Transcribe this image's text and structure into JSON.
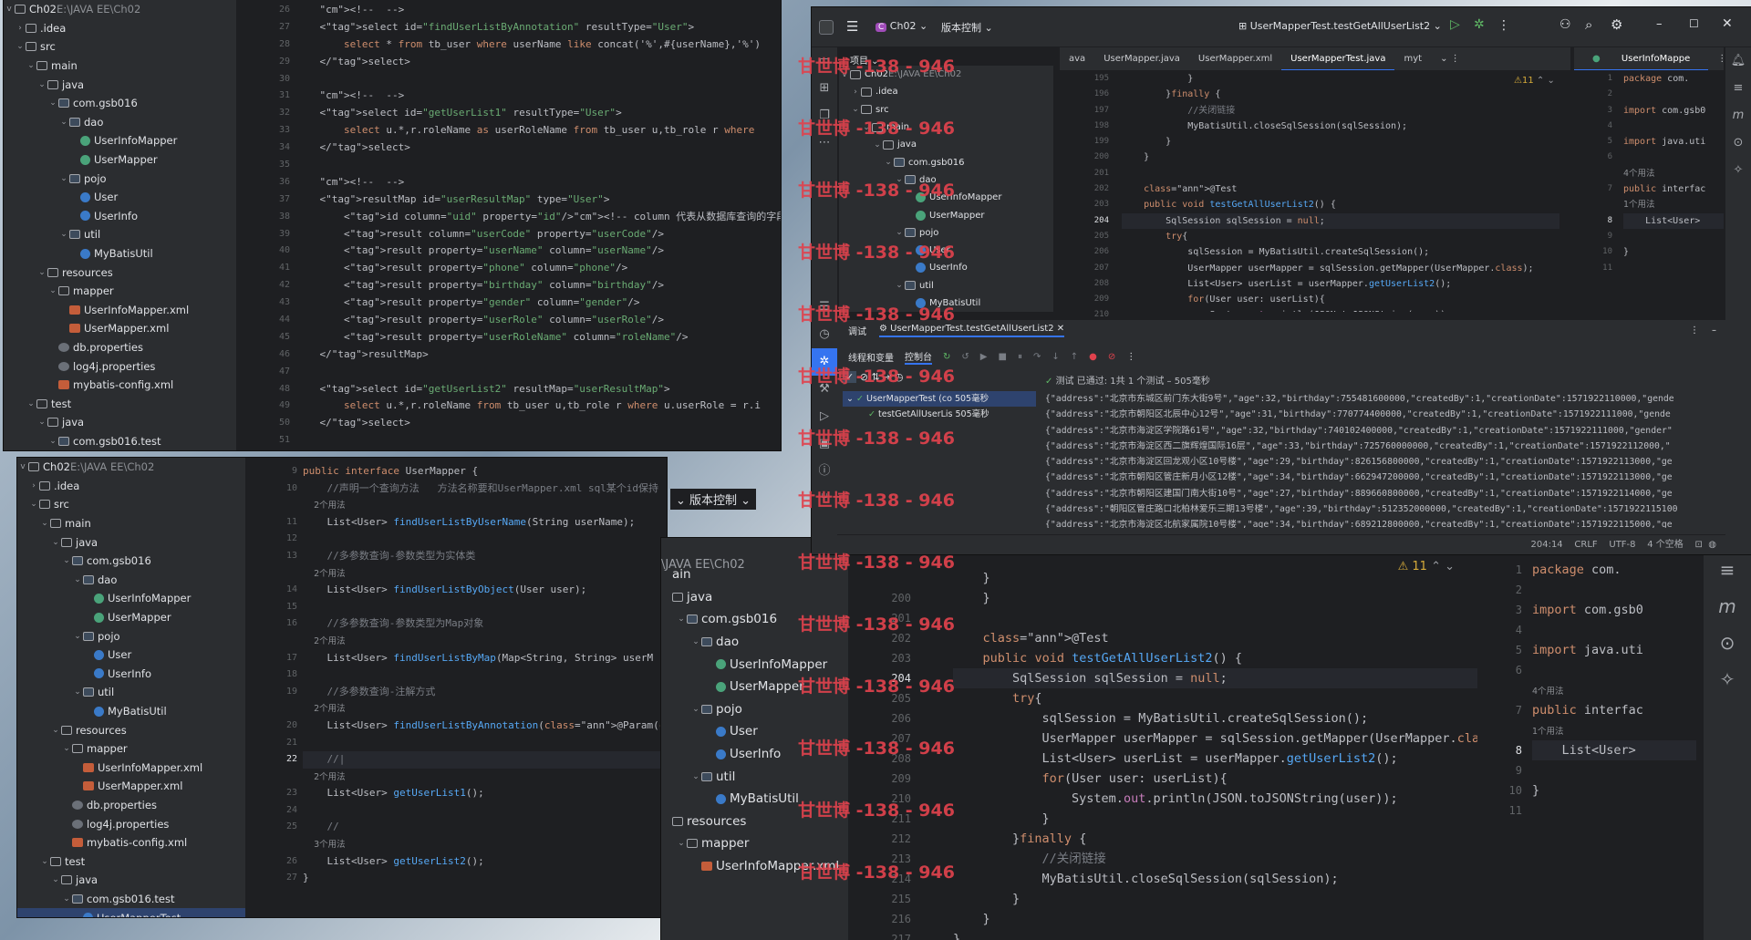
{
  "watermark": "甘世博 -138 - 946",
  "topleft": {
    "tree_header": "Ch02",
    "tree_header_path": "E:\\JAVA EE\\Ch02",
    "tree": [
      {
        "t": ".idea",
        "l": 1,
        "a": ">",
        "i": "folder"
      },
      {
        "t": "src",
        "l": 1,
        "a": "v",
        "i": "folder"
      },
      {
        "t": "main",
        "l": 2,
        "a": "v",
        "i": "folder"
      },
      {
        "t": "java",
        "l": 3,
        "a": "v",
        "i": "folder"
      },
      {
        "t": "com.gsb016",
        "l": 4,
        "a": "v",
        "i": "pkg"
      },
      {
        "t": "dao",
        "l": 5,
        "a": "v",
        "i": "pkg"
      },
      {
        "t": "UserInfoMapper",
        "l": 6,
        "a": "",
        "i": "iface"
      },
      {
        "t": "UserMapper",
        "l": 6,
        "a": "",
        "i": "iface"
      },
      {
        "t": "pojo",
        "l": 5,
        "a": "v",
        "i": "pkg"
      },
      {
        "t": "User",
        "l": 6,
        "a": "",
        "i": "cls"
      },
      {
        "t": "UserInfo",
        "l": 6,
        "a": "",
        "i": "cls"
      },
      {
        "t": "util",
        "l": 5,
        "a": "v",
        "i": "pkg"
      },
      {
        "t": "MyBatisUtil",
        "l": 6,
        "a": "",
        "i": "cls"
      },
      {
        "t": "resources",
        "l": 3,
        "a": "v",
        "i": "folder"
      },
      {
        "t": "mapper",
        "l": 4,
        "a": "v",
        "i": "folder"
      },
      {
        "t": "UserInfoMapper.xml",
        "l": 5,
        "a": "",
        "i": "xml"
      },
      {
        "t": "UserMapper.xml",
        "l": 5,
        "a": "",
        "i": "xml"
      },
      {
        "t": "db.properties",
        "l": 4,
        "a": "",
        "i": "prop"
      },
      {
        "t": "log4j.properties",
        "l": 4,
        "a": "",
        "i": "prop"
      },
      {
        "t": "mybatis-config.xml",
        "l": 4,
        "a": "",
        "i": "xml"
      },
      {
        "t": "test",
        "l": 2,
        "a": "v",
        "i": "folder"
      },
      {
        "t": "java",
        "l": 3,
        "a": "v",
        "i": "folder"
      },
      {
        "t": "com.gsb016.test",
        "l": 4,
        "a": "v",
        "i": "pkg"
      }
    ],
    "lines": [
      "26",
      "27",
      "28",
      "29",
      "30",
      "31",
      "32",
      "33",
      "34",
      "35",
      "36",
      "37",
      "38",
      "39",
      "40",
      "41",
      "42",
      "43",
      "44",
      "45",
      "46",
      "47",
      "48",
      "49",
      "50",
      "51"
    ],
    "code": [
      "    <!--  -->",
      "    <select id=\"findUserListByAnnotation\" resultType=\"User\">",
      "        select * from tb_user where userName like concat('%',#{userName},'%')",
      "    </select>",
      "",
      "    <!--  -->",
      "    <select id=\"getUserList1\" resultType=\"User\">",
      "        select u.*,r.roleName as userRoleName from tb_user u,tb_role r where",
      "    </select>",
      "",
      "    <!--  -->",
      "    <resultMap id=\"userResultMap\" type=\"User\">",
      "        <id column=\"uid\" property=\"id\"/><!-- column 代表从数据库查询的字段名称或者",
      "        <result column=\"userCode\" property=\"userCode\"/>",
      "        <result property=\"userName\" column=\"userName\"/>",
      "        <result property=\"phone\" column=\"phone\"/>",
      "        <result property=\"birthday\" column=\"birthday\"/>",
      "        <result property=\"gender\" column=\"gender\"/>",
      "        <result property=\"userRole\" column=\"userRole\"/>",
      "        <result property=\"userRoleName\" column=\"roleName\"/>",
      "    </resultMap>",
      "",
      "    <select id=\"getUserList2\" resultMap=\"userResultMap\">",
      "        select u.*,r.roleName from tb_user u,tb_role r where u.userRole = r.i",
      "    </select>",
      ""
    ]
  },
  "midleft": {
    "tree_header": "Ch02",
    "tree_header_path": "E:\\JAVA EE\\Ch02",
    "tree": [
      {
        "t": ".idea",
        "l": 1,
        "a": ">",
        "i": "folder"
      },
      {
        "t": "src",
        "l": 1,
        "a": "v",
        "i": "folder"
      },
      {
        "t": "main",
        "l": 2,
        "a": "v",
        "i": "folder"
      },
      {
        "t": "java",
        "l": 3,
        "a": "v",
        "i": "folder"
      },
      {
        "t": "com.gsb016",
        "l": 4,
        "a": "v",
        "i": "pkg"
      },
      {
        "t": "dao",
        "l": 5,
        "a": "v",
        "i": "pkg"
      },
      {
        "t": "UserInfoMapper",
        "l": 6,
        "a": "",
        "i": "iface"
      },
      {
        "t": "UserMapper",
        "l": 6,
        "a": "",
        "i": "iface"
      },
      {
        "t": "pojo",
        "l": 5,
        "a": "v",
        "i": "pkg"
      },
      {
        "t": "User",
        "l": 6,
        "a": "",
        "i": "cls"
      },
      {
        "t": "UserInfo",
        "l": 6,
        "a": "",
        "i": "cls"
      },
      {
        "t": "util",
        "l": 5,
        "a": "v",
        "i": "pkg"
      },
      {
        "t": "MyBatisUtil",
        "l": 6,
        "a": "",
        "i": "cls"
      },
      {
        "t": "resources",
        "l": 3,
        "a": "v",
        "i": "folder"
      },
      {
        "t": "mapper",
        "l": 4,
        "a": "v",
        "i": "folder"
      },
      {
        "t": "UserInfoMapper.xml",
        "l": 5,
        "a": "",
        "i": "xml"
      },
      {
        "t": "UserMapper.xml",
        "l": 5,
        "a": "",
        "i": "xml"
      },
      {
        "t": "db.properties",
        "l": 4,
        "a": "",
        "i": "prop"
      },
      {
        "t": "log4j.properties",
        "l": 4,
        "a": "",
        "i": "prop"
      },
      {
        "t": "mybatis-config.xml",
        "l": 4,
        "a": "",
        "i": "xml"
      },
      {
        "t": "test",
        "l": 2,
        "a": "v",
        "i": "folder"
      },
      {
        "t": "java",
        "l": 3,
        "a": "v",
        "i": "folder"
      },
      {
        "t": "com.gsb016.test",
        "l": 4,
        "a": "v",
        "i": "pkg"
      },
      {
        "t": "UserMapperTest",
        "l": 5,
        "a": "",
        "i": "cls",
        "sel": true
      }
    ],
    "lines": [
      "9",
      "10",
      "",
      "11",
      "12",
      "13",
      "",
      "14",
      "15",
      "16",
      "",
      "17",
      "18",
      "19",
      "",
      "20",
      "21",
      "22",
      "",
      "23",
      "24",
      "25",
      "",
      "26",
      "27"
    ],
    "code": [
      "public interface UserMapper {",
      "    //声明一个查询方法   方法名称要和UserMapper.xml sql某个id保持",
      "    2个用法",
      "    List<User> findUserListByUserName(String userName);",
      "",
      "    //多参数查询-参数类型为实体类",
      "    2个用法",
      "    List<User> findUserListByObject(User user);",
      "",
      "    //多参数查询-参数类型为Map对象",
      "    2个用法",
      "    List<User> findUserListByMap(Map<String, String> userM",
      "",
      "    //多参数查询-注解方式",
      "    2个用法",
      "    List<User> findUserListByAnnotation(@Param(\"userName\")",
      "",
      "    //|",
      "    2个用法",
      "    List<User> getUserList1();",
      "",
      "    //",
      "    3个用法",
      "    List<User> getUserList2();",
      "}"
    ]
  },
  "topright": {
    "project": "Ch02",
    "vcs": "版本控制",
    "run_config": "UserMapperTest.testGetAllUserList2",
    "project_label": "项目",
    "tree_header": "Ch02",
    "tree_header_path": "E:\\JAVA EE\\Ch02",
    "tree": [
      {
        "t": ".idea",
        "l": 1,
        "a": ">",
        "i": "folder"
      },
      {
        "t": "src",
        "l": 1,
        "a": "v",
        "i": "folder"
      },
      {
        "t": "main",
        "l": 2,
        "a": "v",
        "i": "folder"
      },
      {
        "t": "java",
        "l": 3,
        "a": "v",
        "i": "folder"
      },
      {
        "t": "com.gsb016",
        "l": 4,
        "a": "v",
        "i": "pkg"
      },
      {
        "t": "dao",
        "l": 5,
        "a": "v",
        "i": "pkg"
      },
      {
        "t": "UserInfoMapper",
        "l": 6,
        "a": "",
        "i": "iface"
      },
      {
        "t": "UserMapper",
        "l": 6,
        "a": "",
        "i": "iface"
      },
      {
        "t": "pojo",
        "l": 5,
        "a": "v",
        "i": "pkg"
      },
      {
        "t": "User",
        "l": 6,
        "a": "",
        "i": "cls"
      },
      {
        "t": "UserInfo",
        "l": 6,
        "a": "",
        "i": "cls"
      },
      {
        "t": "util",
        "l": 5,
        "a": "v",
        "i": "pkg"
      },
      {
        "t": "MyBatisUtil",
        "l": 6,
        "a": "",
        "i": "cls"
      }
    ],
    "tabs": [
      "ava",
      "UserMapper.java",
      "UserMapper.xml",
      "UserMapperTest.java",
      "myt"
    ],
    "right_tab": "UserInfoMappe",
    "inspections": "11",
    "lines": [
      "195",
      "196",
      "197",
      "198",
      "199",
      "200",
      "201",
      "202",
      "203",
      "204",
      "205",
      "206",
      "207",
      "208",
      "209",
      "210"
    ],
    "code": [
      "            }",
      "        }finally {",
      "            //关闭链接",
      "            MyBatisUtil.closeSqlSession(sqlSession);",
      "        }",
      "    }",
      "",
      "    @Test",
      "    public void testGetAllUserList2() {",
      "        SqlSession sqlSession = null;",
      "        try{",
      "            sqlSession = MyBatisUtil.createSqlSession();",
      "            UserMapper userMapper = sqlSession.getMapper(UserMapper.class);",
      "            List<User> userList = userMapper.getUserList2();",
      "            for(User user: userList){",
      "                System.out.println(JSON.toJSONString(user));"
    ],
    "side_lines": [
      "1",
      "2",
      "3",
      "4",
      "5",
      "6",
      "",
      "7",
      "",
      "8",
      "9",
      "10",
      "11"
    ],
    "side_code": [
      "package com.",
      "",
      "import com.gsb0",
      "",
      "import java.uti",
      "",
      "4个用法",
      "public interfac",
      "1个用法",
      "    List<User>",
      "",
      "}",
      ""
    ],
    "debug_title": "调试",
    "debug_tab": "UserMapperTest.testGetAllUserList2",
    "threads_label": "线程和变量",
    "console_label": "控制台",
    "test_status": "测试 已通过: 1共 1 个测试 – 505毫秒",
    "test_root": "UserMapperTest (co 505毫秒",
    "test_child": "testGetAllUserLis 505毫秒",
    "console": [
      "{\"address\":\"北京市东城区前门东大街9号\",\"age\":32,\"birthday\":755481600000,\"createdBy\":1,\"creationDate\":1571922110000,\"gende",
      "{\"address\":\"北京市朝阳区北辰中心12号\",\"age\":31,\"birthday\":770774400000,\"createdBy\":1,\"creationDate\":1571922111000,\"gende",
      "{\"address\":\"北京市海淀区学院路61号\",\"age\":32,\"birthday\":740102400000,\"createdBy\":1,\"creationDate\":1571922111000,\"gender\"",
      "{\"address\":\"北京市海淀区西二旗辉煌国际16层\",\"age\":33,\"birthday\":725760000000,\"createdBy\":1,\"creationDate\":1571922112000,\"",
      "{\"address\":\"北京市海淀区回龙观小区10号楼\",\"age\":29,\"birthday\":826156800000,\"createdBy\":1,\"creationDate\":1571922113000,\"ge",
      "{\"address\":\"北京市朝阳区管庄新月小区12楼\",\"age\":34,\"birthday\":662947200000,\"createdBy\":1,\"creationDate\":1571922113000,\"ge",
      "{\"address\":\"北京市朝阳区建国门南大街10号\",\"age\":27,\"birthday\":889660800000,\"createdBy\":1,\"creationDate\":1571922114000,\"ge",
      "{\"address\":\"朝阳区管庄路口北柏林爱乐三期13号楼\",\"age\":39,\"birthday\":512352000000,\"createdBy\":1,\"creationDate\":1571922115100",
      "{\"address\":\"北京市海淀区北航家属院10号楼\",\"age\":34,\"birthday\":689212800000,\"createdBy\":1,\"creationDate\":1571922115000,\"ge"
    ],
    "status": [
      "204:14",
      "CRLF",
      "UTF-8",
      "4 个空格"
    ]
  },
  "bottomright": {
    "vcs": "版本控制",
    "path": "\\JAVA EE\\Ch02",
    "tree": [
      {
        "t": "ain",
        "l": 0,
        "a": "",
        "i": ""
      },
      {
        "t": "java",
        "l": 0,
        "a": "",
        "i": "folder"
      },
      {
        "t": "com.gsb016",
        "l": 1,
        "a": "v",
        "i": "pkg"
      },
      {
        "t": "dao",
        "l": 2,
        "a": "v",
        "i": "pkg"
      },
      {
        "t": "UserInfoMapper",
        "l": 3,
        "a": "",
        "i": "iface"
      },
      {
        "t": "UserMapper",
        "l": 3,
        "a": "",
        "i": "iface"
      },
      {
        "t": "pojo",
        "l": 2,
        "a": "v",
        "i": "pkg"
      },
      {
        "t": "User",
        "l": 3,
        "a": "",
        "i": "cls"
      },
      {
        "t": "UserInfo",
        "l": 3,
        "a": "",
        "i": "cls"
      },
      {
        "t": "util",
        "l": 2,
        "a": "v",
        "i": "pkg"
      },
      {
        "t": "MyBatisUtil",
        "l": 3,
        "a": "",
        "i": "cls"
      },
      {
        "t": "resources",
        "l": 0,
        "a": "",
        "i": "folder"
      },
      {
        "t": "mapper",
        "l": 1,
        "a": "v",
        "i": "folder"
      },
      {
        "t": "UserInfoMapper.xml",
        "l": 2,
        "a": "",
        "i": "xml"
      }
    ],
    "inspections": "11",
    "lines": [
      "",
      "200",
      "201",
      "202",
      "203",
      "204",
      "205",
      "206",
      "207",
      "208",
      "209",
      "210",
      "211",
      "212",
      "213",
      "214",
      "215",
      "216",
      "217"
    ],
    "code": [
      "    }",
      "    }",
      "",
      "    @Test",
      "    public void testGetAllUserList2() {",
      "        SqlSession sqlSession = null;",
      "        try{",
      "            sqlSession = MyBatisUtil.createSqlSession();",
      "            UserMapper userMapper = sqlSession.getMapper(UserMapper.class);",
      "            List<User> userList = userMapper.getUserList2();",
      "            for(User user: userList){",
      "                System.out.println(JSON.toJSONString(user));",
      "            }",
      "        }finally {",
      "            //关闭链接",
      "            MyBatisUtil.closeSqlSession(sqlSession);",
      "        }",
      "    }",
      "}"
    ],
    "side_lines": [
      "1",
      "2",
      "3",
      "4",
      "5",
      "6",
      "",
      "7",
      "",
      "8",
      "9",
      "10",
      "11"
    ],
    "side_code": [
      "package com.",
      "",
      "import com.gsb0",
      "",
      "import java.uti",
      "",
      "4个用法",
      "public interfac",
      "1个用法",
      "    List<User>",
      "",
      "}",
      ""
    ]
  }
}
